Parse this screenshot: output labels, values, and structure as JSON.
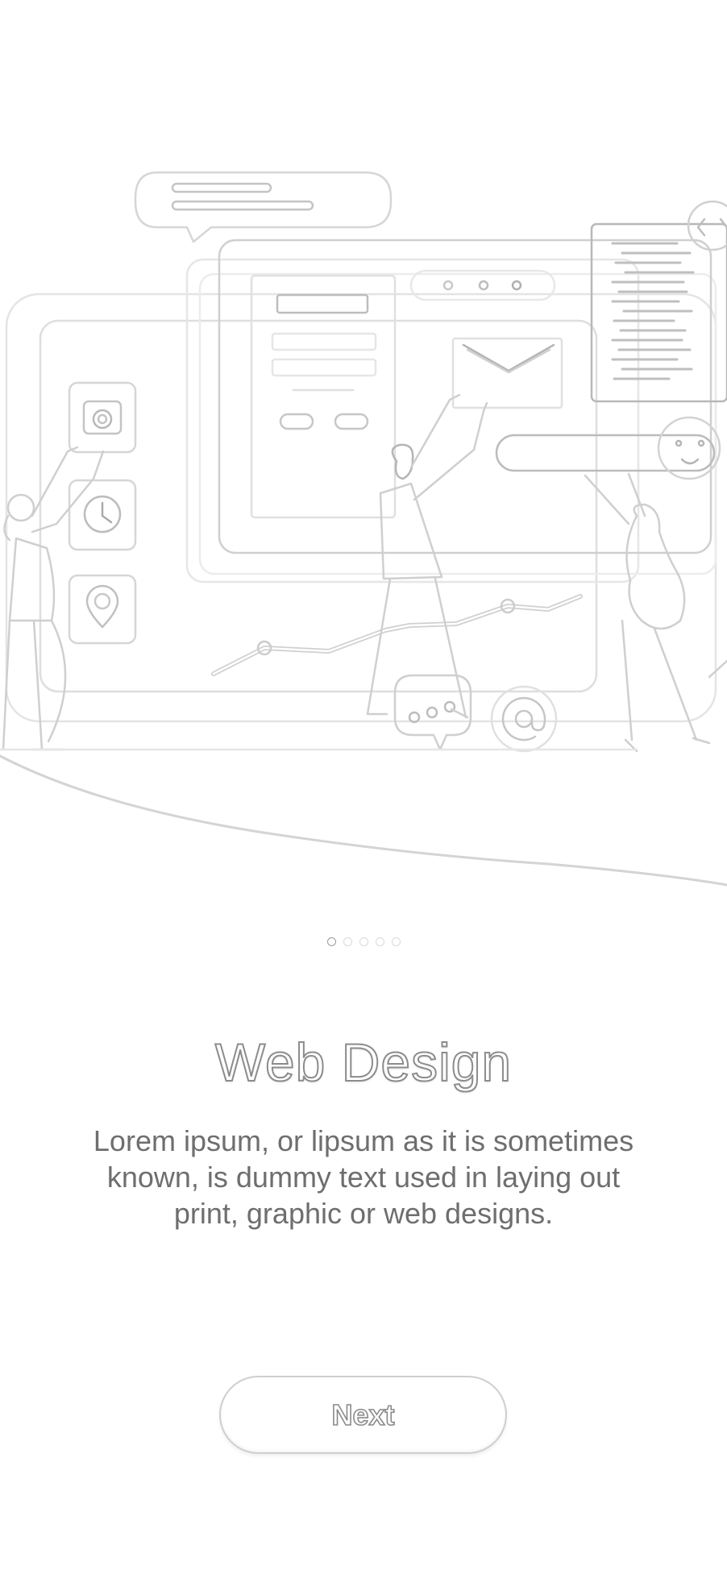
{
  "onboarding": {
    "illustration_icons": [
      "chat-bubble-icon",
      "camera-icon",
      "clock-icon",
      "location-pin-icon",
      "envelope-icon",
      "code-icon",
      "smiley-icon",
      "at-sign-icon",
      "message-dots-icon"
    ],
    "pager": {
      "total": 5,
      "active_index": 0
    },
    "title": "Web Design",
    "description": "Lorem ipsum, or lipsum as it is sometimes known, is dummy text used in laying out print, graphic or web designs.",
    "next_label": "Next"
  },
  "colors": {
    "background": "#ffffff",
    "line": "#d4d4d4",
    "text": "#6e6e6e",
    "title_outline": "#8c8c8c"
  }
}
